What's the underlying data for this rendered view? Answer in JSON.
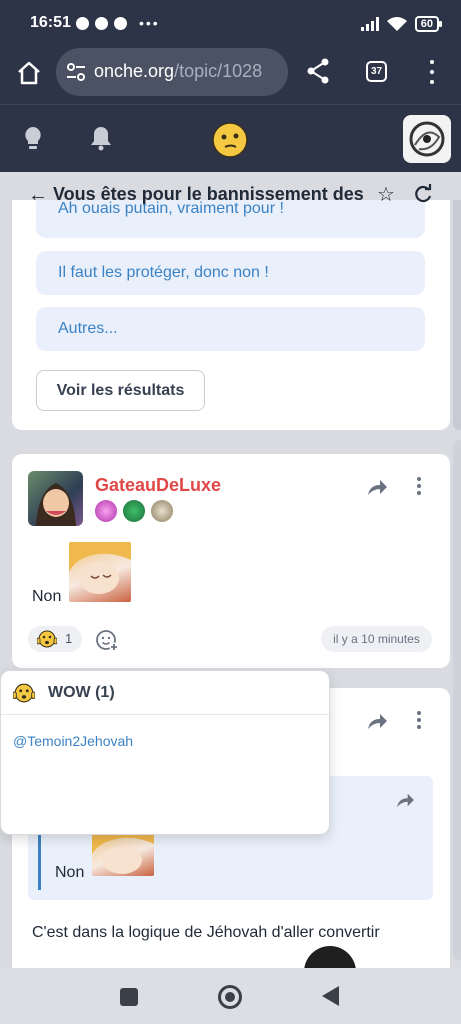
{
  "status_bar": {
    "time": "16:51",
    "battery": "60"
  },
  "browser": {
    "url_domain": "onche.org",
    "url_path": "/topic/1028",
    "tab_count": "37"
  },
  "topic": {
    "title": "Vous êtes pour le bannissement des té"
  },
  "poll": {
    "options": [
      "Ah ouais putain, vraiment pour !",
      "Il faut les protéger, donc non !",
      "Autres..."
    ],
    "results_button": "Voir les résultats"
  },
  "post": {
    "author": "GateauDeLuxe",
    "text": "Non",
    "reaction_count": "1",
    "time": "il y a 10 minutes"
  },
  "reaction_popup": {
    "title": "WOW (1)",
    "user": "@Temoin2Jehovah"
  },
  "post2": {
    "quote_text": "Non",
    "body": "C'est dans la logique de Jéhovah d'aller convertir"
  },
  "colors": {
    "header_bg": "#2d3447",
    "page_bg": "#d9dbe0",
    "author_red": "#e04848",
    "link_blue": "#3b82c4",
    "poll_option_bg": "#eaf0fb"
  },
  "icons": [
    "home-icon",
    "site-settings-icon",
    "share-icon",
    "tabs-icon",
    "more-icon",
    "lightbulb-icon",
    "bell-icon",
    "smiley-logo-icon",
    "back-arrow-icon",
    "star-icon",
    "reload-icon",
    "wow-emoji-icon",
    "add-reaction-icon"
  ]
}
